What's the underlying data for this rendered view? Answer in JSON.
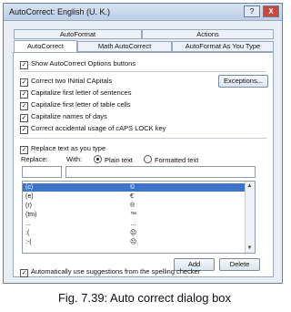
{
  "window": {
    "title": "AutoCorrect: English (U. K.)",
    "help_label": "?",
    "close_label": "X"
  },
  "tabs": {
    "back_row": [
      {
        "label": "AutoFormat"
      },
      {
        "label": "Actions"
      }
    ],
    "front_row": [
      {
        "label": "AutoCorrect"
      },
      {
        "label": "Math AutoCorrect"
      },
      {
        "label": "AutoFormat As You Type"
      }
    ],
    "active": "AutoCorrect"
  },
  "options": {
    "show_buttons": {
      "label": "Show AutoCorrect Options buttons",
      "checked": true
    },
    "checks": [
      {
        "label": "Correct two INitial CApitals",
        "checked": true
      },
      {
        "label": "Capitalize first letter of sentences",
        "checked": true
      },
      {
        "label": "Capitalize first letter of table cells",
        "checked": true
      },
      {
        "label": "Capitalize names of days",
        "checked": true
      },
      {
        "label": "Correct accidental usage of cAPS LOCK key",
        "checked": true
      }
    ],
    "exceptions_label": "Exceptions..."
  },
  "replace": {
    "checkbox_label": "Replace text as you type",
    "replace_label": "Replace:",
    "with_label": "With:",
    "plain_text_label": "Plain text",
    "formatted_text_label": "Formatted text",
    "selected_mode": "plain",
    "replace_value": "",
    "with_value": ""
  },
  "entries": [
    {
      "replace": "(c)",
      "with": "©"
    },
    {
      "replace": "(e)",
      "with": "€"
    },
    {
      "replace": "(r)",
      "with": "®"
    },
    {
      "replace": "(tm)",
      "with": "™"
    },
    {
      "replace": "...",
      "with": "…"
    },
    {
      "replace": ":(",
      "with": "☹"
    },
    {
      "replace": ":-(",
      "with": "☹"
    }
  ],
  "buttons": {
    "add_label": "Add",
    "delete_label": "Delete"
  },
  "suggestions": {
    "label": "Automatically use suggestions from the spelling checker",
    "checked": true
  },
  "caption": "Fig. 7.39: Auto correct dialog box"
}
